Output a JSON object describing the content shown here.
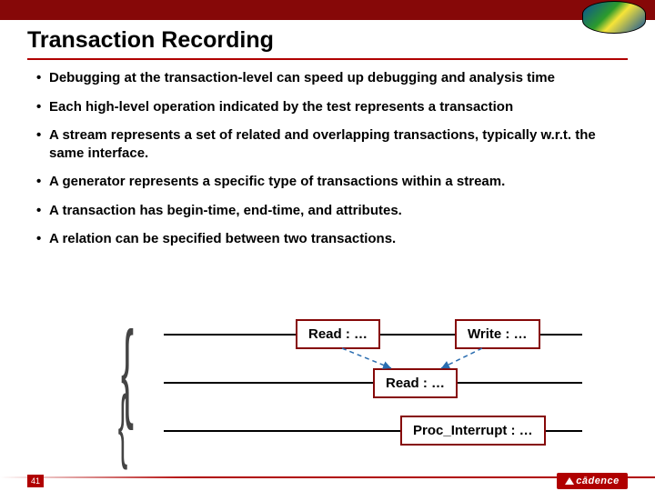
{
  "title": "Transaction Recording",
  "bullets": [
    "Debugging at the transaction-level can speed up debugging and analysis time",
    "Each high-level operation indicated by the test represents a transaction",
    "A stream represents a set of related and overlapping transactions, typically w.r.t. the same interface.",
    "A generator represents a specific type of transactions within a stream.",
    "A transaction has begin-time, end-time, and attributes.",
    "A relation can be specified between two transactions."
  ],
  "diagram": {
    "read1": "Read : …",
    "write": "Write : …",
    "read2": "Read : …",
    "proc": "Proc_Interrupt : …"
  },
  "footer": {
    "page": "41",
    "brand": "cādence"
  }
}
